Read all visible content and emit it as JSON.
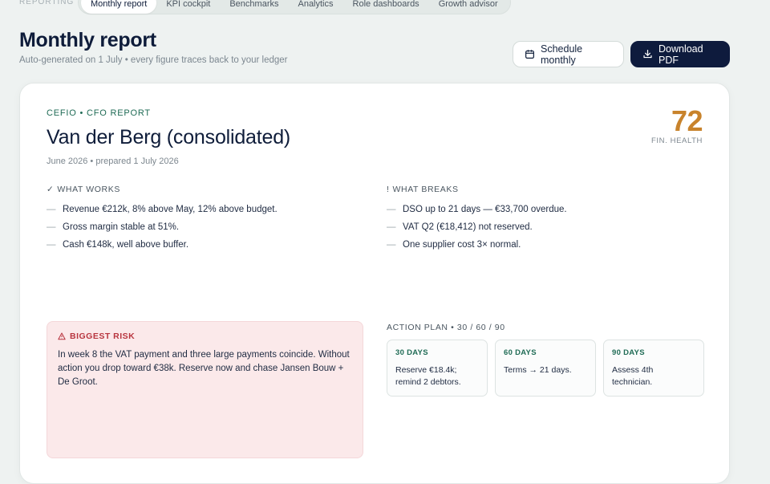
{
  "nav": {
    "section_label": "REPORTING",
    "tabs": [
      {
        "label": "Monthly report",
        "active": true
      },
      {
        "label": "KPI cockpit",
        "active": false
      },
      {
        "label": "Benchmarks",
        "active": false
      },
      {
        "label": "Analytics",
        "active": false
      },
      {
        "label": "Role dashboards",
        "active": false
      },
      {
        "label": "Growth advisor",
        "active": false
      }
    ]
  },
  "header": {
    "title": "Monthly report",
    "subtitle": "Auto-generated on 1 July • every figure traces back to your ledger",
    "schedule_label": "Schedule monthly",
    "schedule_icon": "calendar-icon",
    "download_label": "Download PDF",
    "download_icon": "download-icon"
  },
  "report": {
    "eyebrow": "CEFIO • CFO REPORT",
    "client": "Van der Berg (consolidated)",
    "period": "June 2026 • prepared 1 July 2026",
    "health_score": "72",
    "health_label": "FIN. HEALTH",
    "works": {
      "glyph": "✓",
      "title": "WHAT WORKS",
      "items": [
        "Revenue €212k, 8% above May, 12% above budget.",
        "Gross margin stable at 51%.",
        "Cash €148k, well above buffer."
      ]
    },
    "breaks": {
      "glyph": "!",
      "title": "WHAT BREAKS",
      "items": [
        "DSO up to 21 days — €33,700 overdue.",
        "VAT Q2 (€18,412) not reserved.",
        "One supplier cost 3× normal."
      ]
    },
    "risk": {
      "title": "BIGGEST RISK",
      "icon": "warning-icon",
      "text": "In week 8 the VAT payment and three large payments coincide. Without action you drop toward €38k. Reserve now and chase Jansen Bouw + De Groot."
    },
    "action_plan": {
      "title": "ACTION PLAN • 30 / 60 / 90",
      "items": [
        {
          "days": "30 DAYS",
          "text": "Reserve €18.4k; remind 2 debtors."
        },
        {
          "days": "60 DAYS",
          "text": "Terms → 21 days."
        },
        {
          "days": "90 DAYS",
          "text": "Assess 4th technician."
        }
      ]
    }
  },
  "colors": {
    "accent_green": "#1f6b55",
    "health_orange": "#c8832c",
    "risk_red": "#b8353f",
    "navy": "#0e1b3d"
  }
}
